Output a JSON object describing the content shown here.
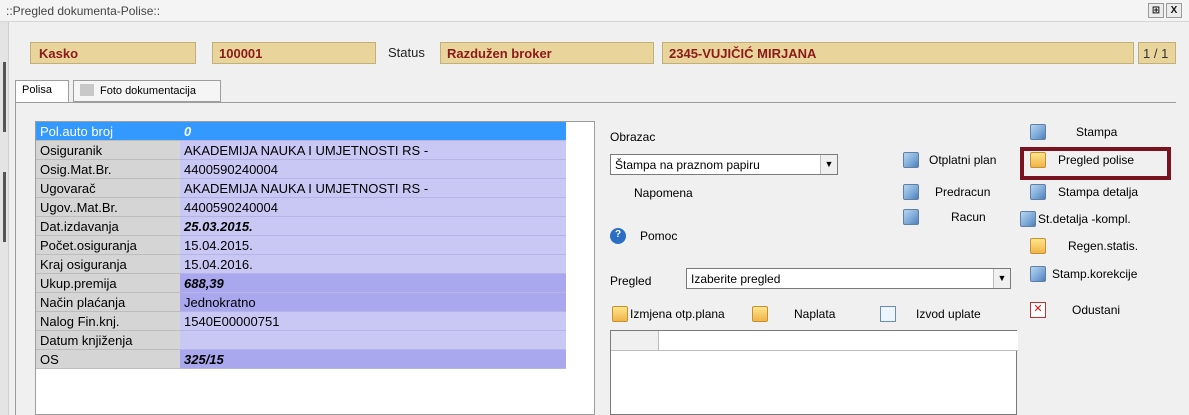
{
  "window": {
    "title": "::Pregled dokumenta-Polise::",
    "buttons": [
      "⊞",
      "X"
    ]
  },
  "header": {
    "product": "Kasko",
    "number": "100001",
    "status_label": "Status",
    "status_value": "Razdužen broker",
    "agent": "2345-VUJIČIĆ MIRJANA",
    "pager": "1 / 1"
  },
  "tabs": [
    {
      "label": "Polisa",
      "active": true
    },
    {
      "label": "Foto dokumentacija",
      "active": false
    }
  ],
  "grid": {
    "rows": [
      {
        "label": "Pol.auto broj",
        "value": "0"
      },
      {
        "label": "Osiguranik",
        "value": "AKADEMIJA NAUKA I UMJETNOSTI RS -"
      },
      {
        "label": "Osig.Mat.Br.",
        "value": "4400590240004"
      },
      {
        "label": "Ugovarač",
        "value": "AKADEMIJA NAUKA I UMJETNOSTI RS -"
      },
      {
        "label": "Ugov..Mat.Br.",
        "value": "4400590240004"
      },
      {
        "label": "Dat.izdavanja",
        "value": "25.03.2015."
      },
      {
        "label": "Počet.osiguranja",
        "value": "15.04.2015."
      },
      {
        "label": "Kraj osiguranja",
        "value": "15.04.2016."
      },
      {
        "label": "Ukup.premija",
        "value": "688,39"
      },
      {
        "label": "Način plaćanja",
        "value": "Jednokratno"
      },
      {
        "label": "Nalog Fin.knj.",
        "value": "1540E00000751"
      },
      {
        "label": "Datum knjiženja",
        "value": ""
      },
      {
        "label": "OS",
        "value": "325/15"
      }
    ]
  },
  "form": {
    "obrazac_label": "Obrazac",
    "obrazac_value": "Štampa na praznom papiru",
    "napomena_label": "Napomena",
    "pomoc_label": "Pomoc",
    "pregled_label": "Pregled",
    "pregled_value": "Izaberite pregled"
  },
  "middle_buttons": {
    "otplatni_plan": "Otplatni plan",
    "predracun": "Predracun",
    "racun": "Racun"
  },
  "bottom_buttons": {
    "izmjena": "Izmjena otp.plana",
    "naplata": "Naplata",
    "izvod": "Izvod uplate"
  },
  "right_buttons": {
    "stampa": "Stampa",
    "pregled_polise": "Pregled polise",
    "stampa_detalja": "Stampa detalja",
    "st_detalja_kompl": "St.detalja -kompl.",
    "regen_statis": "Regen.statis.",
    "stamp_korekcije": "Stamp.korekcije",
    "odustani": "Odustani"
  },
  "colors": {
    "header_bg": "#e9d59c",
    "header_text": "#8b1a1a",
    "grid_value_bg": "#c9c8f4",
    "grid_value_dark_bg": "#a9a8ee",
    "selection": "#3399ff",
    "highlight_border": "#7a1320"
  }
}
